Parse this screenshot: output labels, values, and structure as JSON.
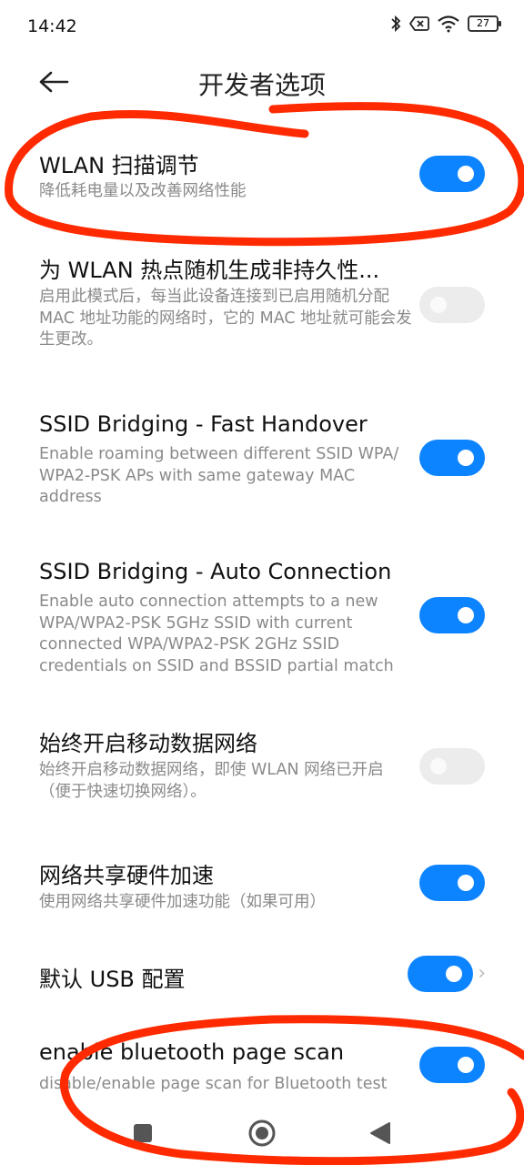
{
  "status": {
    "time": "14:42",
    "battery": "27"
  },
  "header": {
    "title": "开发者选项"
  },
  "settings": [
    {
      "title": "WLAN 扫描调节",
      "desc": "降低耗电量以及改善网络性能",
      "state": "on"
    },
    {
      "title": "为 WLAN 热点随机生成非持久性...",
      "desc": "启用此模式后，每当此设备连接到已启用随机分配 MAC 地址功能的网络时，它的 MAC 地址就可能会发生更改。",
      "state": "off"
    },
    {
      "title": "SSID Bridging - Fast Handover",
      "desc": "Enable roaming between different SSID WPA/ WPA2-PSK APs with same gateway MAC address",
      "state": "on"
    },
    {
      "title": "SSID Bridging - Auto Connection",
      "desc": "Enable auto connection attempts to a new WPA/WPA2-PSK 5GHz SSID with current connected WPA/WPA2-PSK 2GHz SSID credentials on SSID and BSSID partial match",
      "state": "on"
    },
    {
      "title": "始终开启移动数据网络",
      "desc": "始终开启移动数据网络，即使 WLAN 网络已开启（便于快速切换网络）。",
      "state": "off"
    },
    {
      "title": "网络共享硬件加速",
      "desc": "使用网络共享硬件加速功能（如果可用）",
      "state": "on"
    },
    {
      "title": "默认 USB 配置",
      "desc": "",
      "state": "on"
    },
    {
      "title": "enable bluetooth page scan",
      "desc": "disable/enable page scan for Bluetooth test",
      "state": "on"
    }
  ],
  "colors": {
    "accent": "#0d84ff",
    "annotation": "#ff2a00"
  }
}
